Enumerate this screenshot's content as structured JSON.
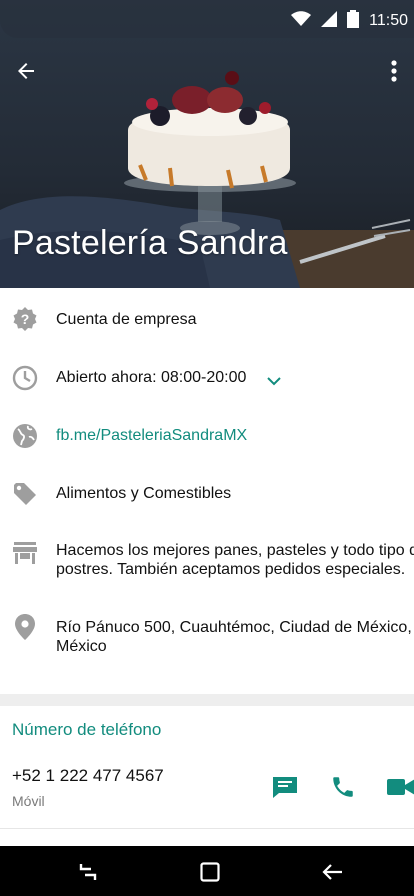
{
  "status": {
    "time": "11:50"
  },
  "header": {
    "title": "Pastelería Sandra"
  },
  "info": {
    "account_type": "Cuenta de empresa",
    "hours": "Abierto ahora: 08:00-20:00",
    "website": "fb.me/PasteleriaSandraMX",
    "category": "Alimentos y Comestibles",
    "description_line1": "Hacemos los mejores panes, pasteles y todo tipo de",
    "description_line2": "postres. También aceptamos pedidos especiales.",
    "address_line1": "Río Pánuco 500, Cuauhtémoc, Ciudad de México,",
    "address_line2": "México"
  },
  "phone": {
    "section_title": "Número de teléfono",
    "number": "+52 1 222 477 4567",
    "label": "Móvil"
  },
  "colors": {
    "accent": "#128C7E",
    "icon_gray": "#9e9e9e"
  },
  "icons": {
    "back": "arrow-left-icon",
    "menu": "more-vert-icon",
    "account": "help-badge-icon",
    "hours": "clock-icon",
    "website": "globe-icon",
    "category": "tag-icon",
    "description": "store-icon",
    "address": "location-pin-icon",
    "message": "message-icon",
    "call": "phone-icon",
    "video": "video-icon"
  }
}
